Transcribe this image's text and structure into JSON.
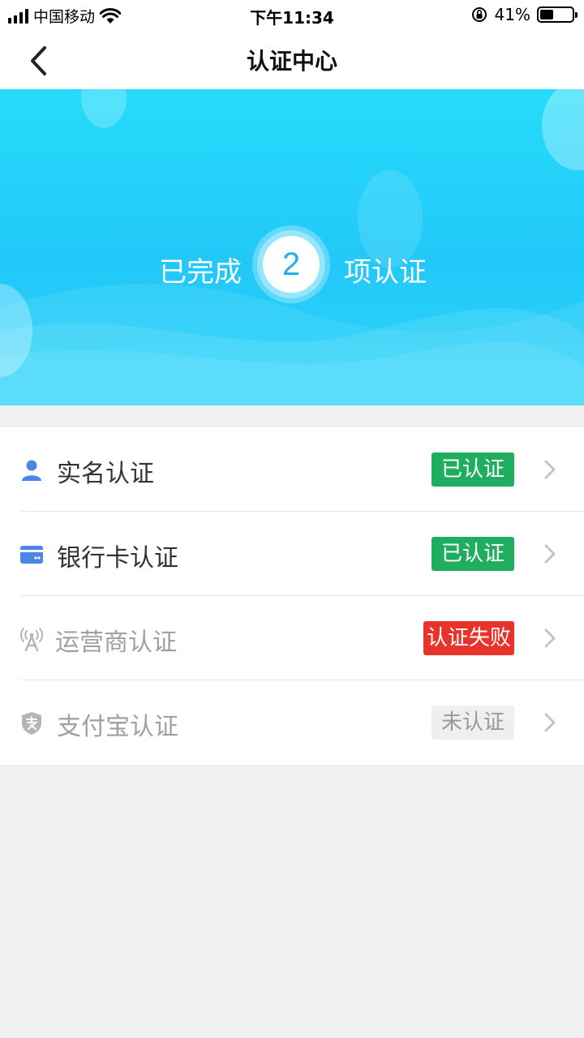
{
  "status_bar": {
    "carrier": "中国移动",
    "time": "下午11:34",
    "battery_percent_label": "41%",
    "battery_level": 0.41,
    "icons": [
      "signal-icon",
      "wifi-icon",
      "rotation-lock-icon",
      "battery-icon"
    ]
  },
  "nav": {
    "title": "认证中心",
    "back_icon": "chevron-left-icon"
  },
  "banner": {
    "prefix": "已完成",
    "count": "2",
    "suffix": "项认证",
    "colors": {
      "gradient_top": "#26dcfb",
      "gradient_bottom": "#2bd6fa",
      "count_text": "#1fb0ee"
    }
  },
  "verifications": [
    {
      "label": "实名认证",
      "icon": "person-icon",
      "icon_color": "#4a86e8",
      "label_color": "#333333",
      "status": "已认证",
      "status_bg": "#1fae5f",
      "status_color": "#ffffff"
    },
    {
      "label": "银行卡认证",
      "icon": "bank-card-icon",
      "icon_color": "#4a86e8",
      "label_color": "#333333",
      "status": "已认证",
      "status_bg": "#1fae5f",
      "status_color": "#ffffff"
    },
    {
      "label": "运营商认证",
      "icon": "signal-tower-icon",
      "icon_color": "#b5b5b5",
      "label_color": "#a0a0a0",
      "status": "认证失败",
      "status_bg": "#e8332b",
      "status_color": "#ffffff"
    },
    {
      "label": "支付宝认证",
      "icon": "alipay-shield-icon",
      "icon_color": "#b5b5b5",
      "label_color": "#a0a0a0",
      "status": "未认证",
      "status_bg": "#efefef",
      "status_color": "#999999"
    }
  ]
}
